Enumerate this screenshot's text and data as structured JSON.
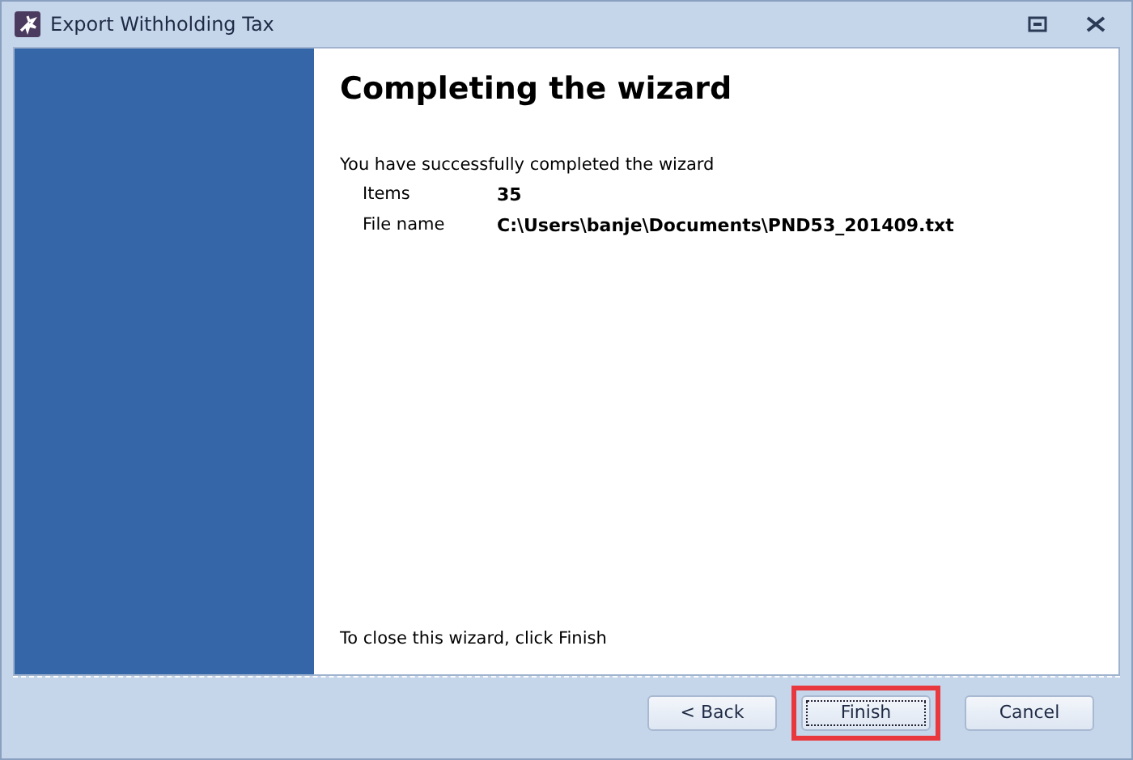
{
  "window": {
    "title": "Export Withholding Tax"
  },
  "heading": "Completing the wizard",
  "intro": "You have successfully completed the wizard",
  "details": [
    {
      "label": "Items",
      "value": "35"
    },
    {
      "label": "File name",
      "value": "C:\\Users\\banje\\Documents\\PND53_201409.txt"
    }
  ],
  "closing_note": "To close this wizard, click Finish",
  "buttons": [
    {
      "label": "< Back",
      "focused": false,
      "highlighted": false
    },
    {
      "label": "Finish",
      "focused": true,
      "highlighted": true
    },
    {
      "label": "Cancel",
      "focused": false,
      "highlighted": false
    }
  ]
}
